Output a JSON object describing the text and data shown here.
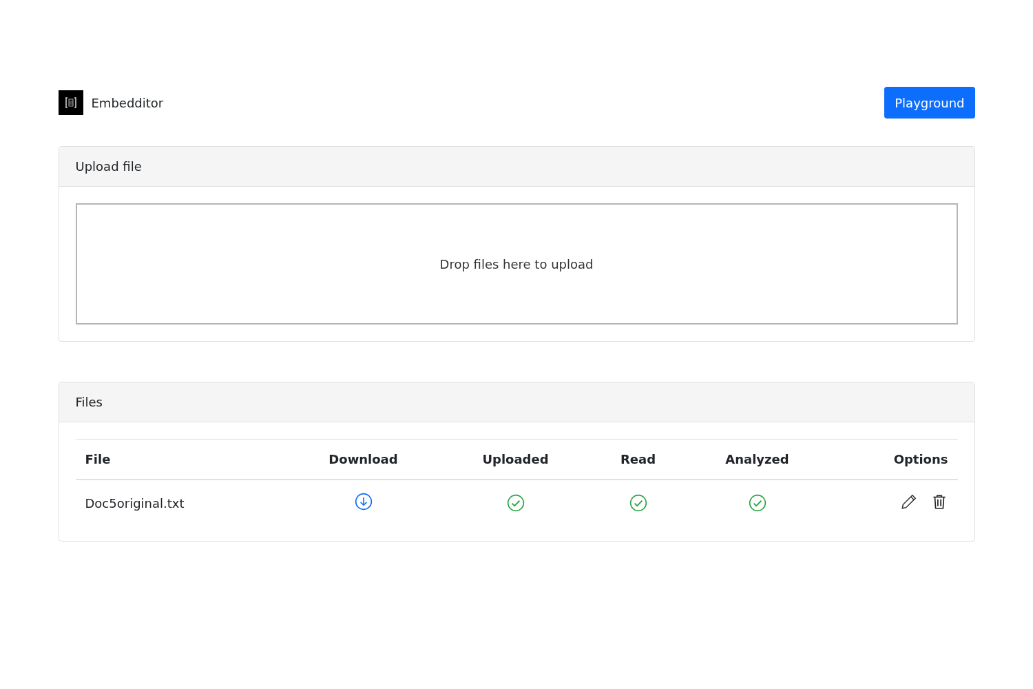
{
  "header": {
    "brand": "Embedditor",
    "button": "Playground"
  },
  "upload": {
    "title": "Upload file",
    "dropzone": "Drop files here to upload"
  },
  "files": {
    "title": "Files",
    "columns": [
      "File",
      "Download",
      "Uploaded",
      "Read",
      "Analyzed",
      "Options"
    ],
    "rows": [
      {
        "name": "Doc5original.txt",
        "uploaded": true,
        "read": true,
        "analyzed": true
      }
    ]
  }
}
